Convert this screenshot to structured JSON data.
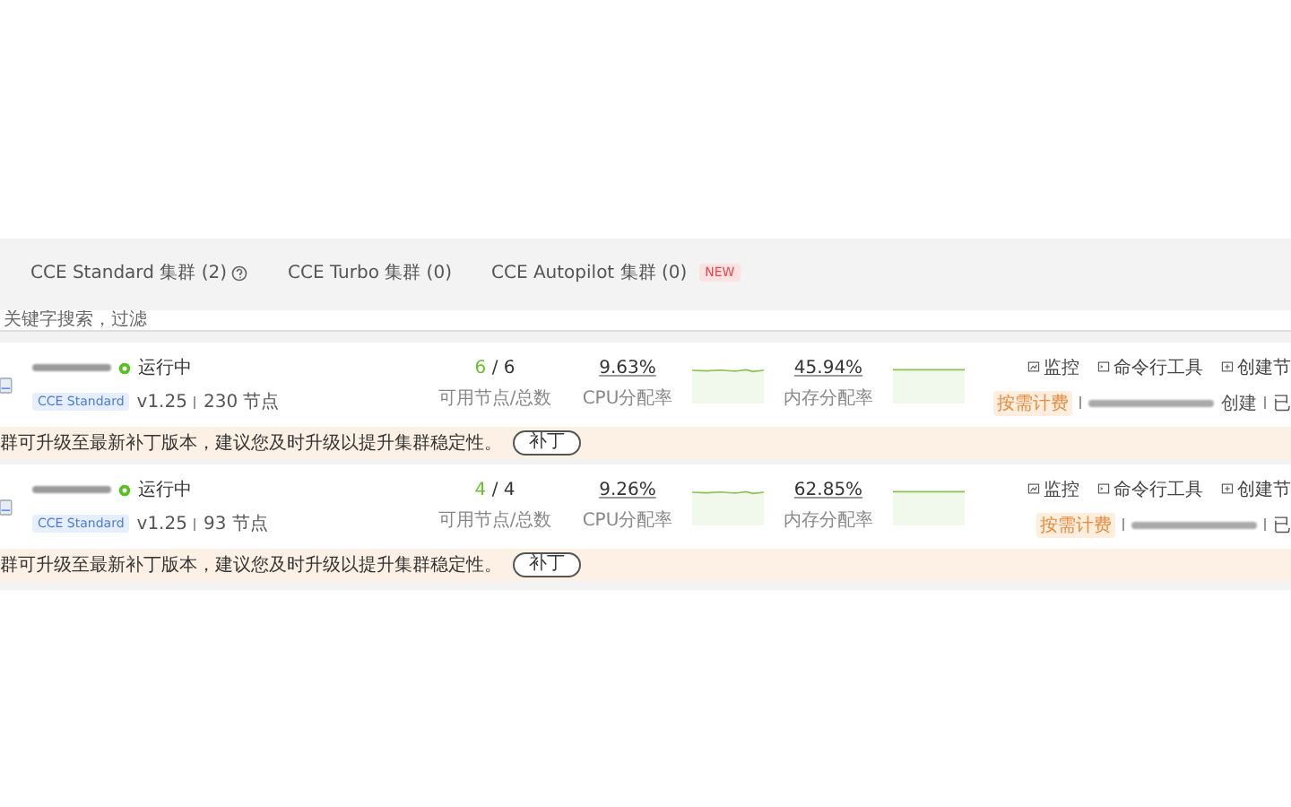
{
  "tabs": [
    {
      "label": "CCE Standard 集群 (2)",
      "help": true,
      "selected": false
    },
    {
      "label": "CCE Turbo 集群 (0)",
      "help": false,
      "selected": false
    },
    {
      "label": "CCE Autopilot 集群 (0)",
      "help": false,
      "badge": "NEW",
      "selected": false
    }
  ],
  "search": {
    "placeholder": "关键字搜索，过滤"
  },
  "clusters": [
    {
      "status": "运行中",
      "type_tag": "CCE Standard",
      "version": "v1.25",
      "nodes": "230 节点",
      "available_nodes": "6",
      "total_nodes": "/ 6",
      "nodes_label": "可用节点/总数",
      "cpu": "9.63%",
      "cpu_label": "CPU分配率",
      "memory": "45.94%",
      "memory_label": "内存分配率",
      "actions": [
        "监控",
        "命令行工具",
        "创建节"
      ],
      "billing": "按需计费",
      "created": "创建",
      "extra": "已",
      "notice": "群可升级至最新补丁版本，建议您及时升级以提升集群稳定性。",
      "notice_button": "补丁"
    },
    {
      "status": "运行中",
      "type_tag": "CCE Standard",
      "version": "v1.25",
      "nodes": "93 节点",
      "available_nodes": "4",
      "total_nodes": "/ 4",
      "nodes_label": "可用节点/总数",
      "cpu": "9.26%",
      "cpu_label": "CPU分配率",
      "memory": "62.85%",
      "memory_label": "内存分配率",
      "actions": [
        "监控",
        "命令行工具",
        "创建节"
      ],
      "billing": "按需计费",
      "extra": "已",
      "notice": "群可升级至最新补丁版本，建议您及时升级以提升集群稳定性。",
      "notice_button": "补丁"
    }
  ]
}
